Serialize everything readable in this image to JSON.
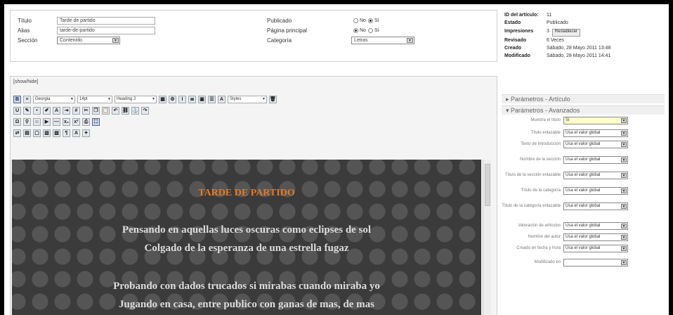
{
  "form": {
    "titulo_label": "Título",
    "titulo_value": "Tarde de partido",
    "alias_label": "Alias",
    "alias_value": "tarde-de-partido",
    "seccion_label": "Sección",
    "seccion_value": "Contenido",
    "publicado_label": "Publicado",
    "pagina_principal_label": "Página principal",
    "categoria_label": "Categoría",
    "categoria_value": "Letras",
    "no_label": "No",
    "si_label": "Sí"
  },
  "editor": {
    "toggle_label": "[show/hide]",
    "font_family": "Georgia",
    "font_size": "14pt",
    "format": "Heading 2",
    "styles": "Styles",
    "content_title": "TARDE DE PARTIDO",
    "lines": [
      "Pensando en aquellas luces oscuras como eclipses de sol",
      "Colgado de la esperanza de una estrella fugaz",
      "Probando con dados trucados si mirabas cuando miraba yo",
      "Jugando en casa, entre publico con ganas de mas, de mas"
    ]
  },
  "info": {
    "id_label": "ID del artículo:",
    "id_value": "11",
    "estado_label": "Estado",
    "estado_value": "Publicado",
    "impresiones_label": "Impresiones",
    "impresiones_value": "3",
    "reset_label": "Restablecer",
    "revisado_label": "Revisado",
    "revisado_value": "6 Veces",
    "creado_label": "Creado",
    "creado_value": "Sábado, 28 Mayo 2011 13:48",
    "modificado_label": "Modificado",
    "modificado_value": "Sábado, 28 Mayo 2011 14:41"
  },
  "params": {
    "articulo_header": "Parámetros - Artículo",
    "avanzados_header": "Parámetros - Avanzados",
    "rows": [
      {
        "label": "Muestra el título",
        "value": "Sí"
      },
      {
        "label": "Título enlazable",
        "value": "Usa el valor global"
      },
      {
        "label": "Texto de introducción",
        "value": "Usa el valor global"
      },
      {
        "label": "Nombre de la sección",
        "value": "Usa el valor global"
      },
      {
        "label": "Título de la sección enlazable",
        "value": "Usa el valor global"
      },
      {
        "label": "Título de la categoría",
        "value": "Usa el valor global"
      },
      {
        "label": "Título de la categoría enlazable",
        "value": "Usa el valor global"
      },
      {
        "label": "Valoración de artículos",
        "value": "Usa el valor global"
      },
      {
        "label": "Nombre del autor",
        "value": "Usa el valor global"
      },
      {
        "label": "Creado en fecha y hora",
        "value": "Usa el valor global"
      },
      {
        "label": "Modificado en",
        "value": ""
      }
    ]
  }
}
